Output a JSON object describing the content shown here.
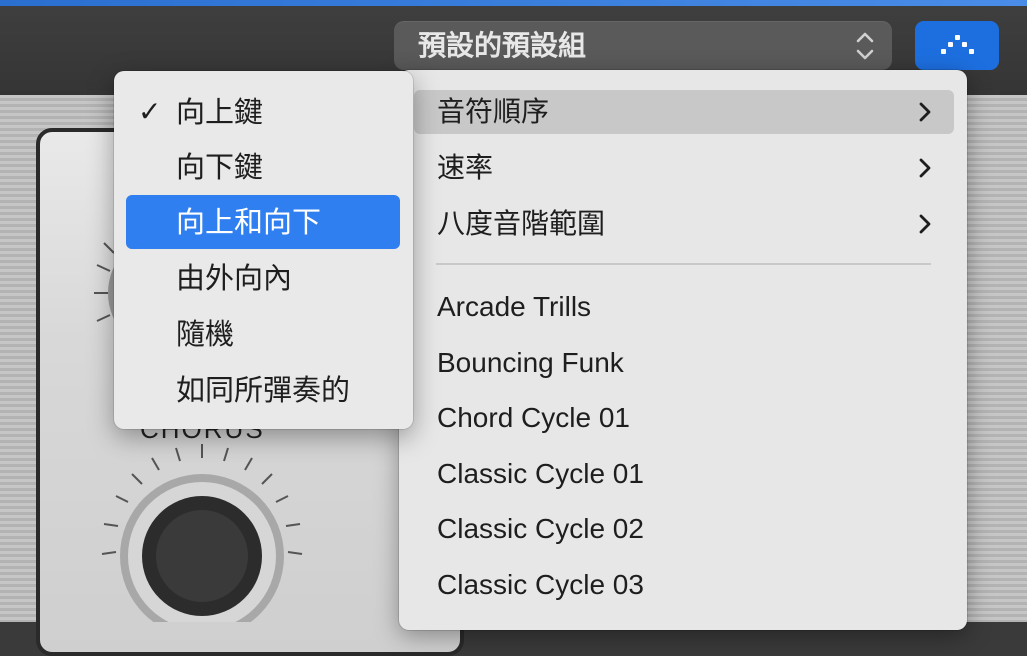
{
  "header": {
    "preset_selector": {
      "value": "預設的預設組"
    },
    "arpeggiator_button": {
      "icon": "arpeggiator-icon",
      "color": "#1d6fe0"
    }
  },
  "background": {
    "panel_label": "CHORUS"
  },
  "menu": {
    "submenu_items": [
      {
        "label": "音符順序",
        "icon": "chevron-right-icon",
        "active": true
      },
      {
        "label": "速率",
        "icon": "chevron-right-icon"
      },
      {
        "label": "八度音階範圍",
        "icon": "chevron-right-icon"
      }
    ],
    "presets": [
      "Arcade Trills",
      "Bouncing Funk",
      "Chord Cycle 01",
      "Classic Cycle 01",
      "Classic Cycle 02",
      "Classic Cycle 03"
    ]
  },
  "note_order_submenu": {
    "check_mark": "✓",
    "items": [
      {
        "label": "向上鍵",
        "checked": true
      },
      {
        "label": "向下鍵"
      },
      {
        "label": "向上和向下",
        "highlighted": true
      },
      {
        "label": "由外向內"
      },
      {
        "label": "隨機"
      },
      {
        "label": "如同所彈奏的"
      }
    ],
    "highlight_color": "#2f7ff0"
  }
}
